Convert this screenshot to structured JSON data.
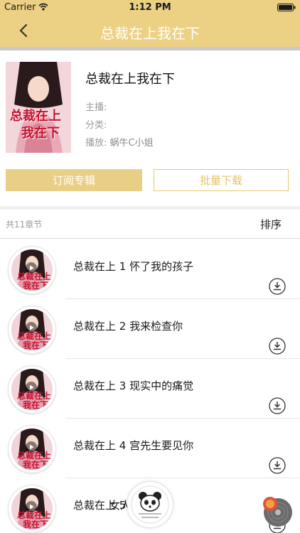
{
  "status_bar": {
    "carrier": "Carrier",
    "time": "1:12 PM"
  },
  "header": {
    "title": "总裁在上我在下"
  },
  "album": {
    "cover_text_line1": "总裁在上",
    "cover_text_line2": "我在下",
    "title": "总裁在上我在下",
    "host_label": "主播:",
    "host_value": "",
    "category_label": "分类:",
    "category_value": "",
    "play_label": "播放:",
    "play_value": "蜗牛C小姐"
  },
  "actions": {
    "subscribe": "订阅专辑",
    "batch_download": "批量下载"
  },
  "list": {
    "count_text": "共11章节",
    "sort_label": "排序",
    "chapters": [
      {
        "title": "总裁在上 1 怀了我的孩子"
      },
      {
        "title": "总裁在上 2 我来检查你"
      },
      {
        "title": "总裁在上 3 现实中的痛觉"
      },
      {
        "title": "总裁在上 4 宫先生要见你"
      },
      {
        "title": "总裁在上 5",
        "title_tail": "女人在"
      }
    ]
  },
  "colors": {
    "header": "#ecd083",
    "accent": "#e9cf85",
    "outline": "#e7c86b"
  }
}
